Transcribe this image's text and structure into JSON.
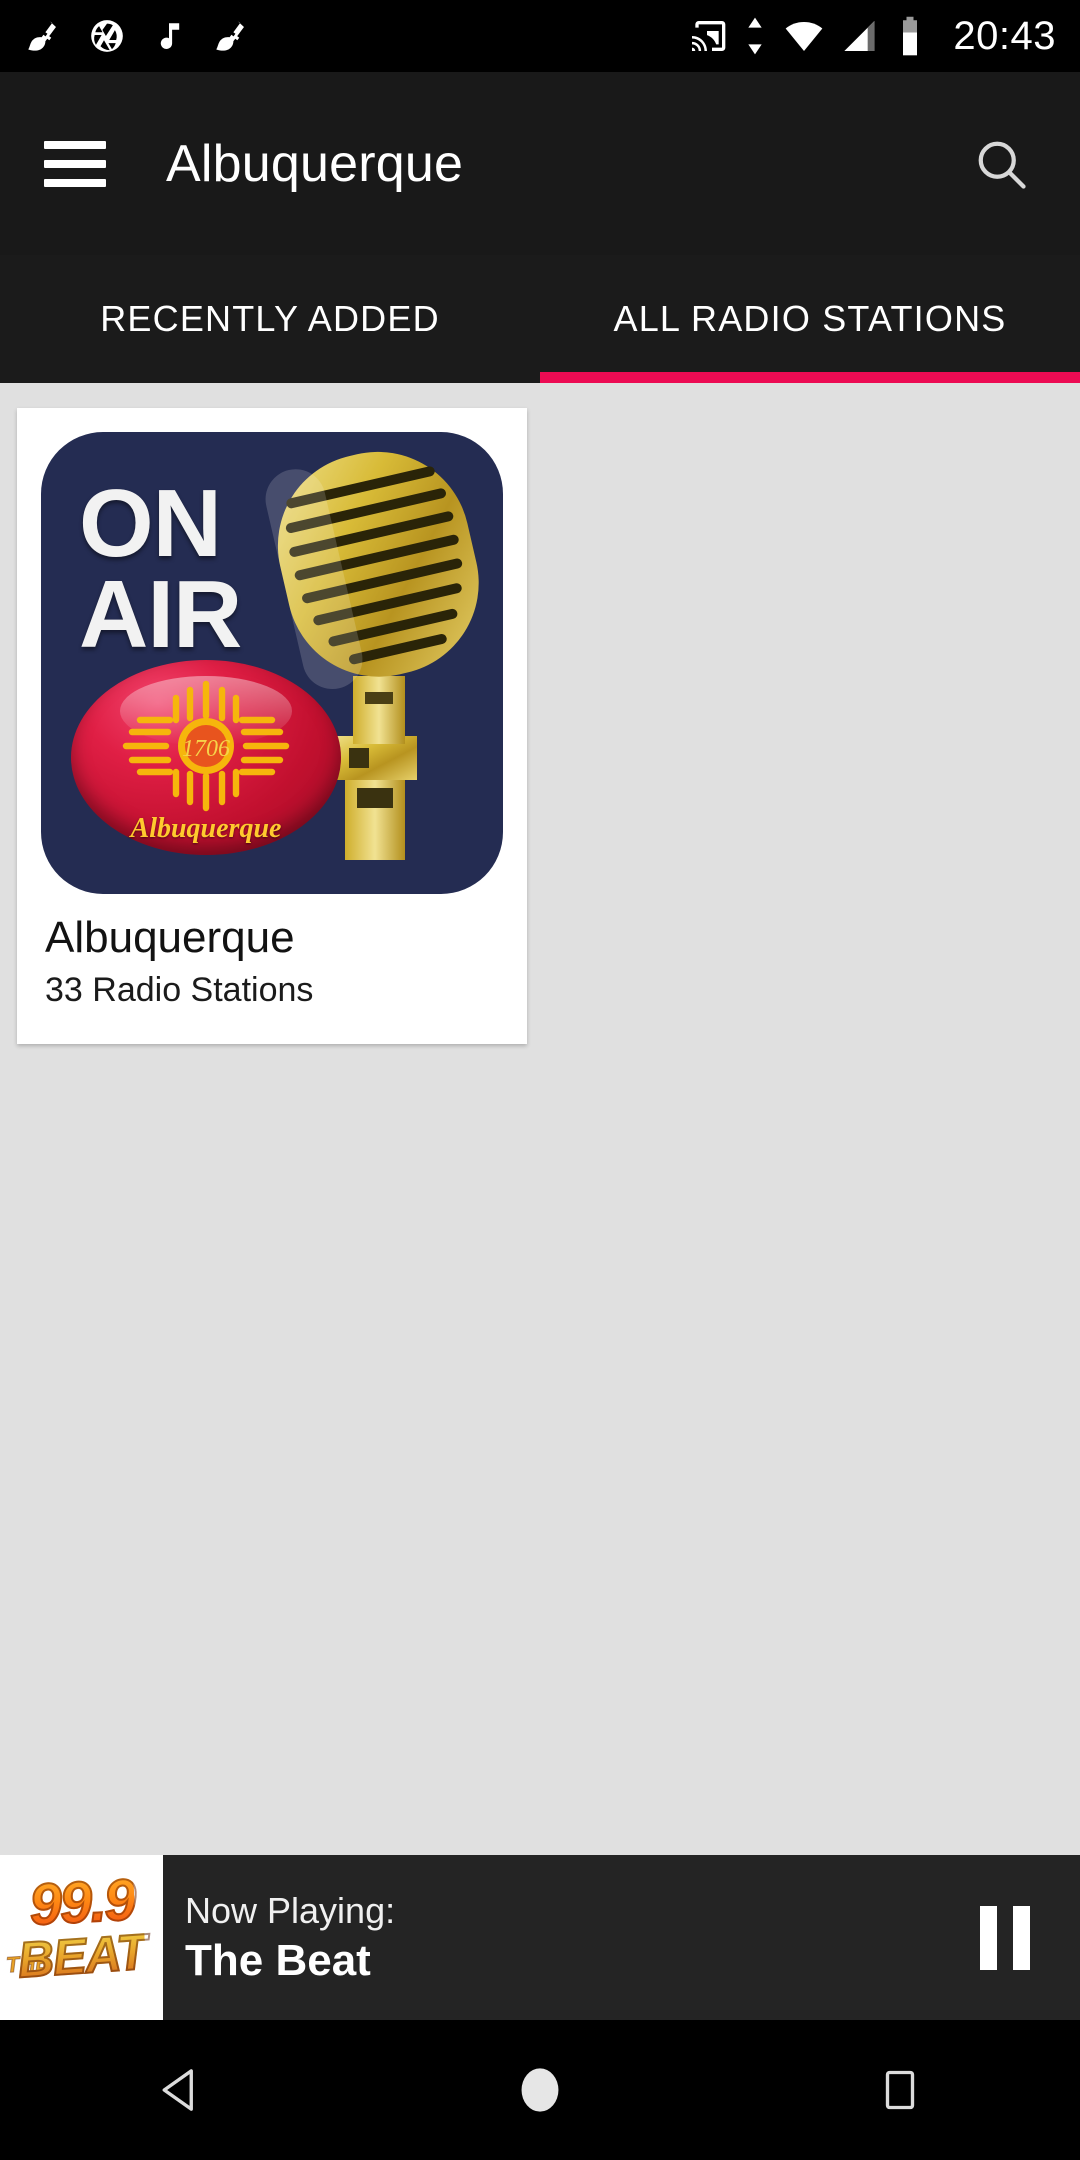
{
  "status_bar": {
    "time": "20:43",
    "left_icons": [
      "broom-icon",
      "camera-aperture-icon",
      "music-note-icon",
      "broom-icon"
    ],
    "right_icons": [
      "cast-icon",
      "sync-arrows-icon",
      "wifi-icon",
      "cellular-signal-icon",
      "battery-icon"
    ]
  },
  "app_bar": {
    "menu_icon": "hamburger-menu-icon",
    "title": "Albuquerque",
    "search_icon": "search-icon"
  },
  "tabs": {
    "active_index": 1,
    "accent_color": "#ec0b53",
    "items": [
      {
        "label": "RECENTLY ADDED"
      },
      {
        "label": "ALL RADIO STATIONS"
      }
    ]
  },
  "content": {
    "background_color": "#e0e0e0",
    "cards": [
      {
        "title": "Albuquerque",
        "subtitle": "33 Radio Stations",
        "thumbnail": {
          "kind": "on-air-microphone-artwork",
          "background_color": "#242c52",
          "headline_line1": "ON",
          "headline_line2": "AIR",
          "badge_text": "Albuquerque",
          "badge_center_text": "1706",
          "badge_color": "#d21836",
          "sun_color": "#f6b60c",
          "mic_color": "#d9b73a"
        }
      }
    ]
  },
  "player": {
    "artwork": {
      "kind": "station-logo",
      "frequency": "99.9",
      "the": "THE",
      "name": "BEAT",
      "background_color": "#ffffff"
    },
    "now_playing_label": "Now Playing:",
    "station_name": "The Beat",
    "control_icon": "pause-icon",
    "background_color": "#242424"
  },
  "nav_bar": {
    "back_icon": "back-triangle-icon",
    "home_icon": "home-circle-icon",
    "recents_icon": "recents-square-icon"
  }
}
